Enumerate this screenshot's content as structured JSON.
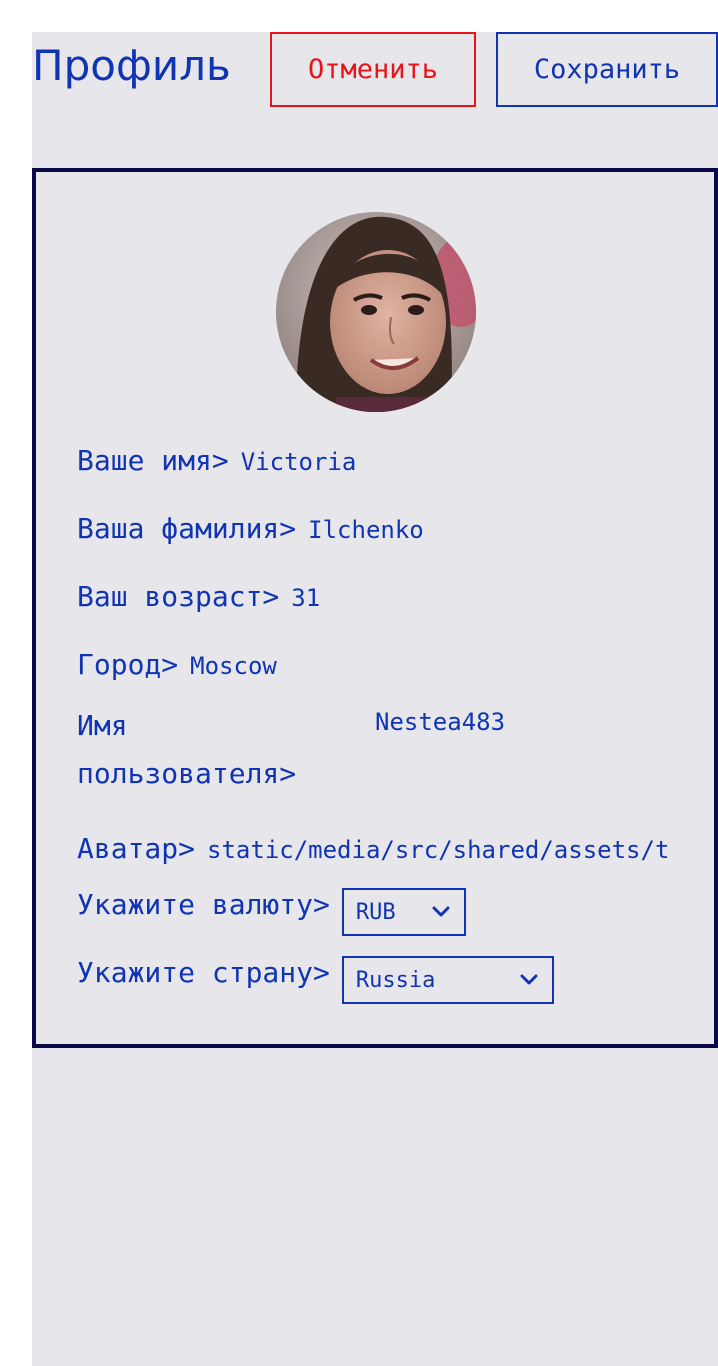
{
  "header": {
    "title": "Профиль",
    "cancel_label": "Отменить",
    "save_label": "Сохранить"
  },
  "profile": {
    "avatar_icon": "user-avatar-photo",
    "fields": [
      {
        "label": "Ваше имя>",
        "value": "Victoria"
      },
      {
        "label": "Ваша фамилия>",
        "value": "Ilchenko"
      },
      {
        "label": "Ваш возраст>",
        "value": "31"
      },
      {
        "label": "Город>",
        "value": "Moscow"
      },
      {
        "label": "Имя пользователя>",
        "value": "Nestea483"
      },
      {
        "label": "Аватар>",
        "value": "static/media/src/shared/assets/t"
      }
    ],
    "currency": {
      "label": "Укажите валюту>",
      "selected": "RUB"
    },
    "country": {
      "label": "Укажите страну>",
      "selected": "Russia"
    }
  },
  "colors": {
    "accent": "#1034b3",
    "danger": "#e8141b",
    "border": "#0a0a4a",
    "background": "#e7e7eb"
  }
}
